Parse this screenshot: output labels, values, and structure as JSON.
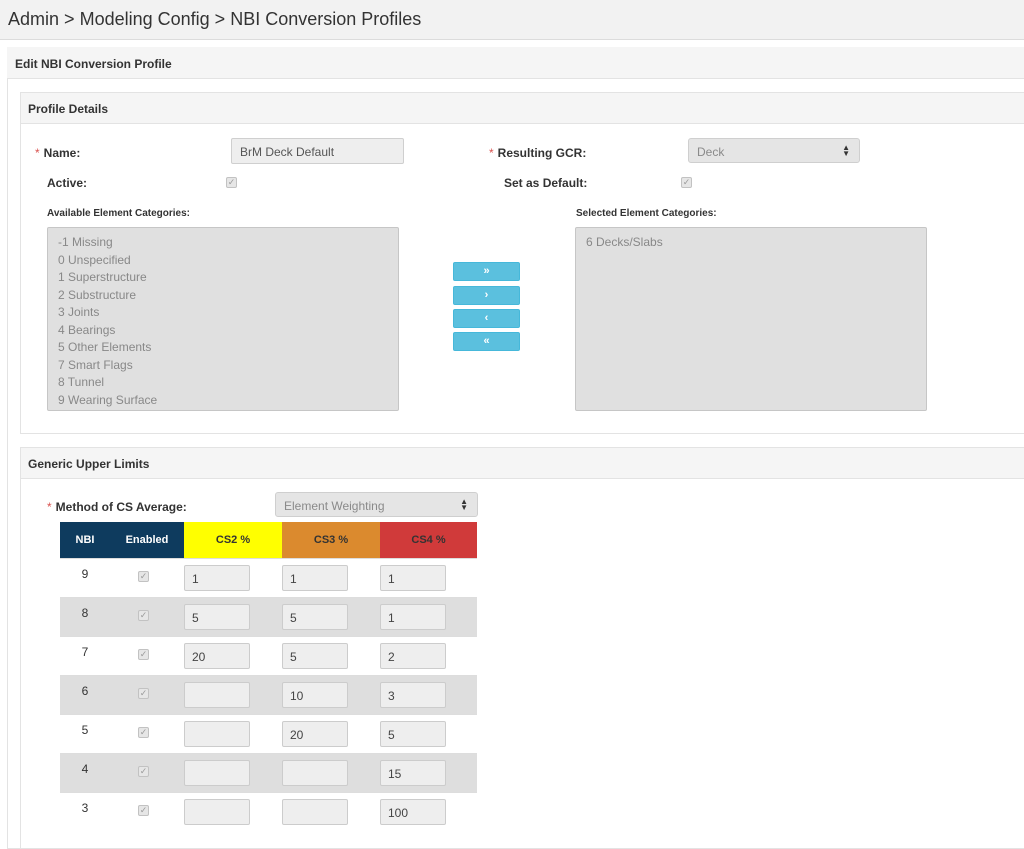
{
  "breadcrumb": {
    "items": [
      "Admin",
      "Modeling Config",
      "NBI Conversion Profiles"
    ],
    "separator": ">"
  },
  "edit_panel": {
    "title": "Edit NBI Conversion Profile"
  },
  "profile_details": {
    "title": "Profile Details",
    "name_label": "Name:",
    "name_value": "BrM Deck Default",
    "gcr_label": "Resulting GCR:",
    "gcr_value": "Deck",
    "active_label": "Active:",
    "active_checked": true,
    "default_label": "Set as Default:",
    "default_checked": true,
    "available_label": "Available Element Categories:",
    "available": [
      "-1 Missing",
      "0 Unspecified",
      "1 Superstructure",
      "2 Substructure",
      "3 Joints",
      "4 Bearings",
      "5 Other Elements",
      "7 Smart Flags",
      "8 Tunnel",
      "9 Wearing Surface"
    ],
    "selected_label": "Selected Element Categories:",
    "selected": [
      "6 Decks/Slabs"
    ],
    "move_buttons": {
      "add_all": "»",
      "add": "›",
      "remove": "‹",
      "remove_all": "«"
    }
  },
  "limits": {
    "title": "Generic Upper Limits",
    "method_label": "Method of CS Average:",
    "method_value": "Element Weighting",
    "columns": [
      "NBI",
      "Enabled",
      "CS2 %",
      "CS3 %",
      "CS4 %"
    ],
    "colors": {
      "nbi": "#0e3b5e",
      "enabled": "#0e3b5e",
      "cs2": "#ffff00",
      "cs3": "#db8a2e",
      "cs4": "#d03a3a"
    },
    "rows": [
      {
        "nbi": "9",
        "enabled": true,
        "cs2": "1",
        "cs3": "1",
        "cs4": "1"
      },
      {
        "nbi": "8",
        "enabled": true,
        "cs2": "5",
        "cs3": "5",
        "cs4": "1"
      },
      {
        "nbi": "7",
        "enabled": true,
        "cs2": "20",
        "cs3": "5",
        "cs4": "2"
      },
      {
        "nbi": "6",
        "enabled": true,
        "cs2": "",
        "cs3": "10",
        "cs4": "3"
      },
      {
        "nbi": "5",
        "enabled": true,
        "cs2": "",
        "cs3": "20",
        "cs4": "5"
      },
      {
        "nbi": "4",
        "enabled": true,
        "cs2": "",
        "cs3": "",
        "cs4": "15"
      },
      {
        "nbi": "3",
        "enabled": true,
        "cs2": "",
        "cs3": "",
        "cs4": "100"
      }
    ]
  }
}
